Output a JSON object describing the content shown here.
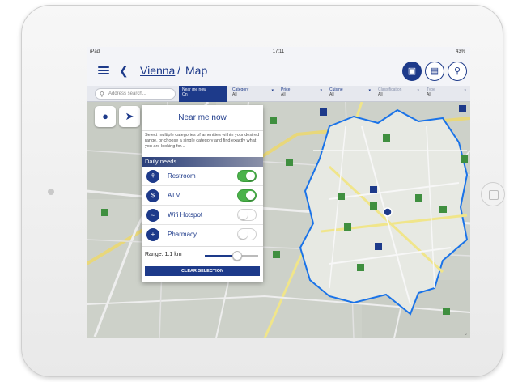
{
  "status": {
    "device": "iPad",
    "time": "17:11",
    "battery": "43%"
  },
  "header": {
    "city": "Vienna",
    "separator": "/",
    "page": "Map"
  },
  "search": {
    "placeholder": "Address search..."
  },
  "filters": [
    {
      "label": "Near me now",
      "value": "On"
    },
    {
      "label": "Category",
      "value": "All"
    },
    {
      "label": "Price",
      "value": "All"
    },
    {
      "label": "Cuisine",
      "value": "All"
    },
    {
      "label": "Classification",
      "value": "All"
    },
    {
      "label": "Type",
      "value": "All"
    }
  ],
  "panel": {
    "title": "Near me now",
    "description": "Select multiple categories of amenities within your desired range, or choose a single category and find exactly what you are looking for...",
    "section": "Daily needs",
    "items": [
      {
        "label": "Restroom",
        "icon": "restroom-icon",
        "on": true
      },
      {
        "label": "ATM",
        "icon": "atm-icon",
        "on": true
      },
      {
        "label": "Wifi Hotspot",
        "icon": "wifi-icon",
        "on": false
      },
      {
        "label": "Pharmacy",
        "icon": "pharmacy-icon",
        "on": false
      }
    ],
    "range_label": "Range: 1.1 km",
    "range_fraction": 0.6,
    "clear_label": "CLEAR SELECTION"
  },
  "colors": {
    "brand": "#1d3a8a",
    "toggle_on": "#4bb24b",
    "area_border": "#1a73e8",
    "marker_green": "#3f8f3f"
  }
}
